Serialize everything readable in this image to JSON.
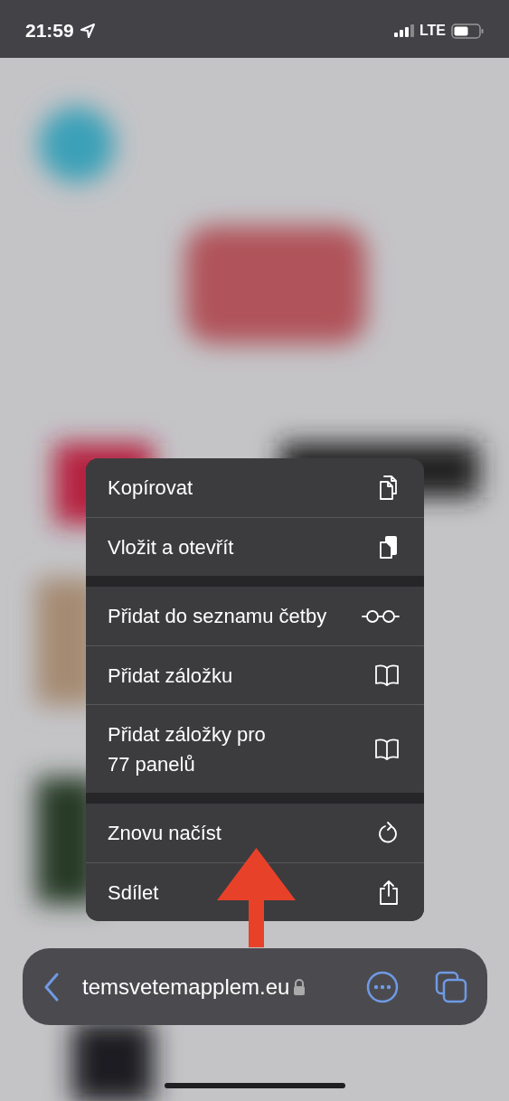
{
  "status_bar": {
    "time": "21:59",
    "network": "LTE"
  },
  "context_menu": {
    "groups": [
      [
        {
          "label": "Kopírovat"
        },
        {
          "label": "Vložit a otevřít"
        }
      ],
      [
        {
          "label": "Přidat do seznamu četby"
        },
        {
          "label": "Přidat záložku"
        },
        {
          "label": "Přidat záložky pro\n77 panelů"
        }
      ],
      [
        {
          "label": "Znovu načíst"
        },
        {
          "label": "Sdílet"
        }
      ]
    ]
  },
  "address_bar": {
    "url": "temsvetemapplem.eu"
  }
}
